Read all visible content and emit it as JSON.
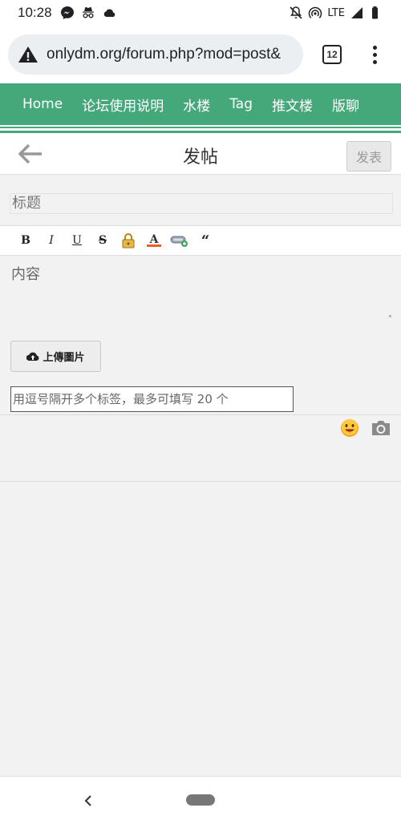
{
  "status_bar": {
    "time": "10:28",
    "network": "LTE",
    "icons_left": [
      "messenger-icon",
      "incognito-icon",
      "cloud-icon"
    ],
    "icons_right": [
      "mute-icon",
      "hotspot-icon",
      "signal-icon",
      "battery-icon"
    ]
  },
  "browser": {
    "url": "onlydm.org/forum.php?mod=post&",
    "tab_count": "12"
  },
  "nav": {
    "items": [
      "Home",
      "论坛使用说明",
      "水楼",
      "Tag",
      "推文楼",
      "版聊"
    ]
  },
  "header": {
    "title": "发帖",
    "post_label": "发表"
  },
  "form": {
    "title_placeholder": "标题",
    "content_placeholder": "内容",
    "upload_label": "上傳圖片",
    "tags_placeholder": "用逗号隔开多个标签，最多可填写 20 个"
  },
  "toolbar": {
    "bold": "B",
    "italic": "I",
    "underline": "U",
    "strike": "S",
    "quote": "“"
  },
  "colors": {
    "nav_green": "#44a87a",
    "background": "#f2f2f2"
  }
}
